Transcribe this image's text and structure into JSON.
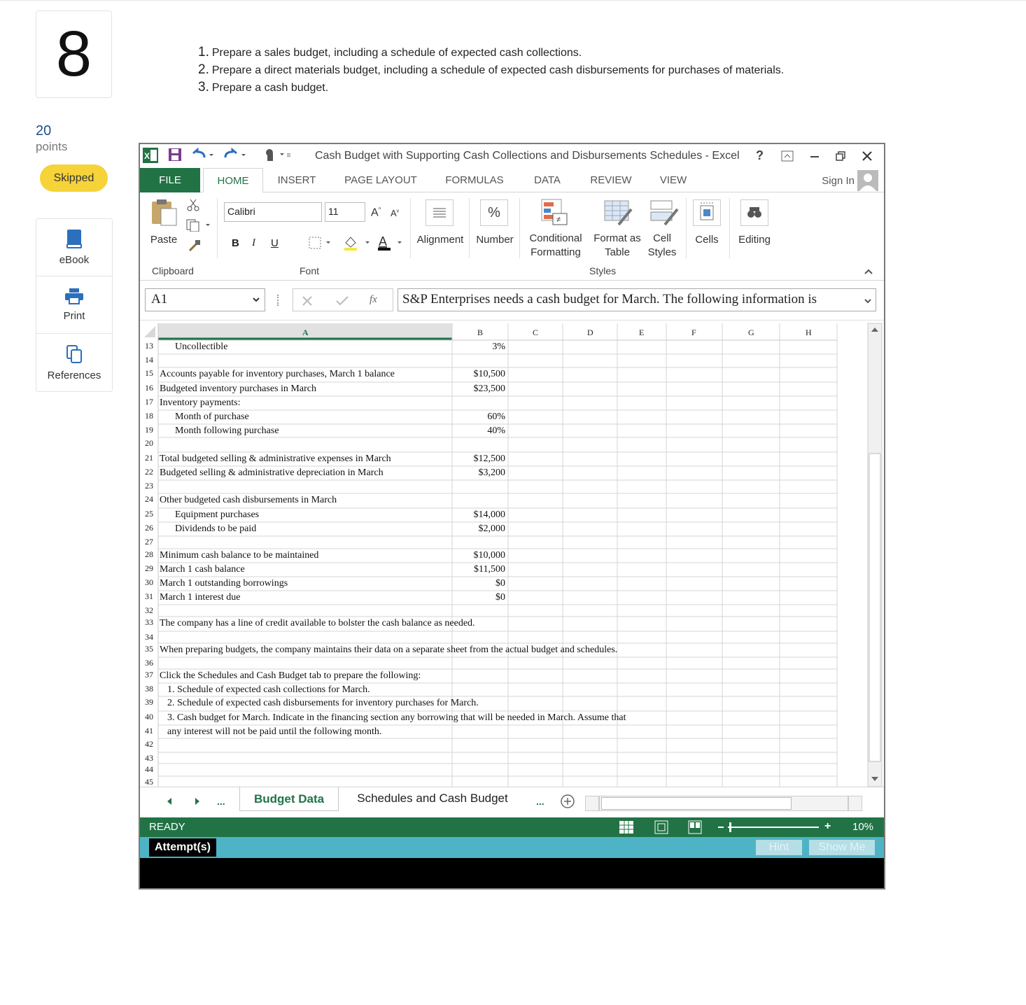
{
  "question": {
    "number": "8",
    "points_value": "20",
    "points_label": "points",
    "status": "Skipped"
  },
  "tools": [
    {
      "label": "eBook",
      "icon": "book-icon"
    },
    {
      "label": "Print",
      "icon": "printer-icon"
    },
    {
      "label": "References",
      "icon": "copy-icon"
    }
  ],
  "instructions": [
    {
      "n": "1.",
      "text": "Prepare a sales budget, including a schedule of expected cash collections."
    },
    {
      "n": "2.",
      "text": "Prepare a direct materials budget, including a schedule of expected cash disbursements for purchases of materials."
    },
    {
      "n": "3.",
      "text": "Prepare a cash budget."
    }
  ],
  "excel": {
    "title": "Cash Budget with Supporting Cash Collections and Disbursements Schedules - Excel",
    "help": "?",
    "tabs": [
      "FILE",
      "HOME",
      "INSERT",
      "PAGE LAYOUT",
      "FORMULAS",
      "DATA",
      "REVIEW",
      "VIEW"
    ],
    "sign_in": "Sign In",
    "ribbon": {
      "paste": "Paste",
      "clipboard": "Clipboard",
      "font_name": "Calibri",
      "font_size": "11",
      "font_group": "Font",
      "bold": "B",
      "italic": "I",
      "underline": "U",
      "alignment": "Alignment",
      "number": "Number",
      "percent": "%",
      "conditional_1": "Conditional",
      "conditional_2": "Formatting",
      "format_table_1": "Format as",
      "format_table_2": "Table",
      "cell_styles_1": "Cell",
      "cell_styles_2": "Styles",
      "styles_group": "Styles",
      "cells": "Cells",
      "editing": "Editing"
    },
    "name_box": "A1",
    "fx": "fx",
    "formula": "S&P Enterprises needs a cash budget for March. The following information is",
    "columns": [
      "A",
      "B",
      "C",
      "D",
      "E",
      "F",
      "G",
      "H"
    ],
    "rows": [
      {
        "num": "13",
        "a": "Uncollectible",
        "indent": 1,
        "b": "3%"
      },
      {
        "num": "14",
        "a": "",
        "indent": 0,
        "b": ""
      },
      {
        "num": "15",
        "a": "Accounts payable for inventory purchases, March 1 balance",
        "indent": 0,
        "b": "$10,500"
      },
      {
        "num": "16",
        "a": "Budgeted inventory purchases in March",
        "indent": 0,
        "b": "$23,500"
      },
      {
        "num": "17",
        "a": "Inventory payments:",
        "indent": 0,
        "b": ""
      },
      {
        "num": "18",
        "a": "Month of purchase",
        "indent": 1,
        "b": "60%"
      },
      {
        "num": "19",
        "a": "Month following purchase",
        "indent": 1,
        "b": "40%"
      },
      {
        "num": "20",
        "a": "",
        "indent": 0,
        "b": ""
      },
      {
        "num": "21",
        "a": "Total budgeted selling & administrative expenses in March",
        "indent": 0,
        "b": "$12,500"
      },
      {
        "num": "22",
        "a": "Budgeted selling & administrative depreciation in March",
        "indent": 0,
        "b": "$3,200"
      },
      {
        "num": "23",
        "a": "",
        "indent": 0,
        "b": ""
      },
      {
        "num": "24",
        "a": "Other budgeted cash disbursements in March",
        "indent": 0,
        "b": ""
      },
      {
        "num": "25",
        "a": "Equipment purchases",
        "indent": 1,
        "b": "$14,000"
      },
      {
        "num": "26",
        "a": "Dividends to be paid",
        "indent": 1,
        "b": "$2,000"
      },
      {
        "num": "27",
        "a": "",
        "indent": 0,
        "b": ""
      },
      {
        "num": "28",
        "a": "Minimum cash balance to be maintained",
        "indent": 0,
        "b": "$10,000"
      },
      {
        "num": "29",
        "a": "March 1 cash balance",
        "indent": 0,
        "b": "$11,500"
      },
      {
        "num": "30",
        "a": "March 1 outstanding borrowings",
        "indent": 0,
        "b": "$0"
      },
      {
        "num": "31",
        "a": "March 1 interest due",
        "indent": 0,
        "b": "$0"
      },
      {
        "num": "32",
        "a": "",
        "indent": 0,
        "b": ""
      },
      {
        "num": "33",
        "a": "The company has a line of credit available to bolster the cash balance as needed.",
        "indent": 0,
        "b": ""
      },
      {
        "num": "34",
        "a": "",
        "indent": 0,
        "b": ""
      },
      {
        "num": "35",
        "a": "When preparing budgets, the company maintains their data on a separate sheet from the actual budget and schedules.",
        "indent": 0,
        "b": ""
      },
      {
        "num": "36",
        "a": "",
        "indent": 0,
        "b": ""
      },
      {
        "num": "37",
        "a": "Click the Schedules and Cash Budget tab to prepare the following:",
        "indent": 0,
        "b": ""
      },
      {
        "num": "38",
        "a": "1. Schedule of expected cash collections for March.",
        "indent": 2,
        "b": ""
      },
      {
        "num": "39",
        "a": "2. Schedule of expected cash disbursements for inventory purchases for March.",
        "indent": 2,
        "b": ""
      },
      {
        "num": "40",
        "a": "3. Cash budget for March. Indicate in the financing section any borrowing that will be needed in March.  Assume that",
        "indent": 2,
        "b": ""
      },
      {
        "num": "41",
        "a": "any interest will not be paid until the following month.",
        "indent": 2,
        "b": ""
      },
      {
        "num": "42",
        "a": "",
        "indent": 0,
        "b": ""
      },
      {
        "num": "43",
        "a": "",
        "indent": 0,
        "b": ""
      },
      {
        "num": "44",
        "a": "",
        "indent": 0,
        "b": ""
      },
      {
        "num": "45",
        "a": "",
        "indent": 0,
        "b": ""
      }
    ],
    "sheet_tabs": [
      "Budget Data",
      "Schedules and Cash Budget"
    ],
    "ellipsis": "...",
    "status": "READY",
    "zoom": "10%",
    "attempts_label": "Attempt(s)",
    "hint_label": "Hint",
    "show_me_label": "Show Me",
    "colors": {
      "excel_green": "#217346",
      "attempt_bar": "#4eb3c5",
      "skipped_badge": "#f5d339"
    }
  }
}
